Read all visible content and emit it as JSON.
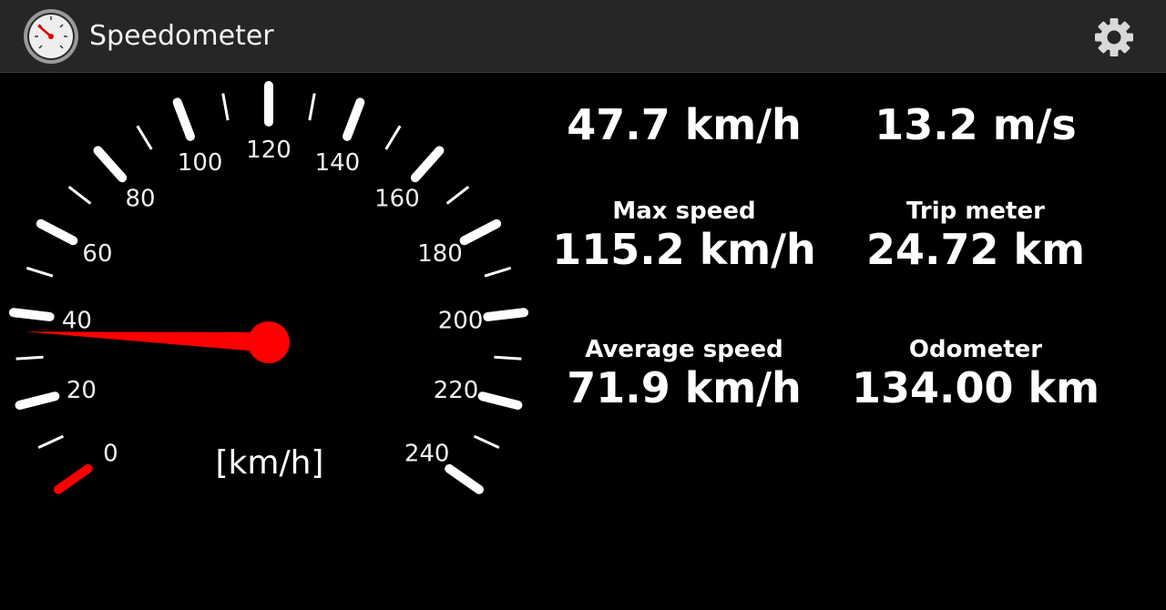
{
  "app": {
    "title": "Speedometer",
    "icon": "speedometer-icon"
  },
  "toolbar": {
    "settings_icon": "gear-icon"
  },
  "gauge": {
    "unit_label": "[km/h]",
    "tick_labels": [
      "0",
      "20",
      "40",
      "60",
      "80",
      "100",
      "120",
      "140",
      "160",
      "180",
      "200",
      "220",
      "240"
    ],
    "min": 0,
    "max": 240,
    "needle_value": 36,
    "accent_color": "#ff0000",
    "tick_color": "#ffffff"
  },
  "stats": {
    "current_speed_kmh": "47.7 km/h",
    "current_speed_ms": "13.2 m/s",
    "max_speed": {
      "label": "Max speed",
      "value": "115.2 km/h"
    },
    "trip_meter": {
      "label": "Trip meter",
      "value": "24.72 km"
    },
    "average_speed": {
      "label": "Average speed",
      "value": "71.9 km/h"
    },
    "odometer": {
      "label": "Odometer",
      "value": "134.00 km"
    }
  }
}
